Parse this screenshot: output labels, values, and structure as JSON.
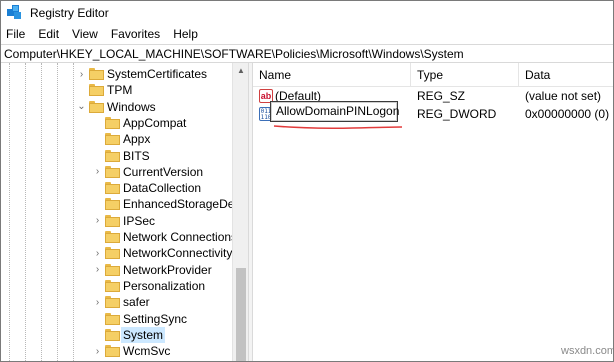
{
  "window": {
    "title": "Registry Editor"
  },
  "menu": [
    "File",
    "Edit",
    "View",
    "Favorites",
    "Help"
  ],
  "address": "Computer\\HKEY_LOCAL_MACHINE\\SOFTWARE\\Policies\\Microsoft\\Windows\\System",
  "tree": {
    "items": [
      {
        "label": "SystemCertificates",
        "expander": "›",
        "selected": false
      },
      {
        "label": "TPM",
        "expander": "",
        "selected": false
      },
      {
        "label": "Windows",
        "expander": "⌄",
        "selected": false
      },
      {
        "label": "AppCompat",
        "expander": "",
        "selected": false
      },
      {
        "label": "Appx",
        "expander": "",
        "selected": false
      },
      {
        "label": "BITS",
        "expander": "",
        "selected": false
      },
      {
        "label": "CurrentVersion",
        "expander": "›",
        "selected": false
      },
      {
        "label": "DataCollection",
        "expander": "",
        "selected": false
      },
      {
        "label": "EnhancedStorageDevic",
        "expander": "",
        "selected": false
      },
      {
        "label": "IPSec",
        "expander": "›",
        "selected": false
      },
      {
        "label": "Network Connections",
        "expander": "",
        "selected": false
      },
      {
        "label": "NetworkConnectivitySt",
        "expander": "›",
        "selected": false
      },
      {
        "label": "NetworkProvider",
        "expander": "›",
        "selected": false
      },
      {
        "label": "Personalization",
        "expander": "",
        "selected": false
      },
      {
        "label": "safer",
        "expander": "›",
        "selected": false
      },
      {
        "label": "SettingSync",
        "expander": "",
        "selected": false
      },
      {
        "label": "System",
        "expander": "",
        "selected": true
      },
      {
        "label": "WcmSvc",
        "expander": "›",
        "selected": false
      }
    ]
  },
  "list": {
    "columns": [
      "Name",
      "Type",
      "Data"
    ],
    "rows": [
      {
        "name": "(Default)",
        "type": "REG_SZ",
        "data": "(value not set)",
        "icon": "string-value-icon"
      },
      {
        "name": "AllowDomainPINLogon",
        "type": "REG_DWORD",
        "data": "0x00000000 (0)",
        "icon": "binary-value-icon"
      }
    ],
    "icon_text": {
      "string": "ab",
      "binary": "011 110"
    }
  },
  "watermark": "wsxdn.com",
  "colors": {
    "selection": "#cce8ff",
    "folder": "#f5cf65",
    "underline": "#e23b3b"
  }
}
